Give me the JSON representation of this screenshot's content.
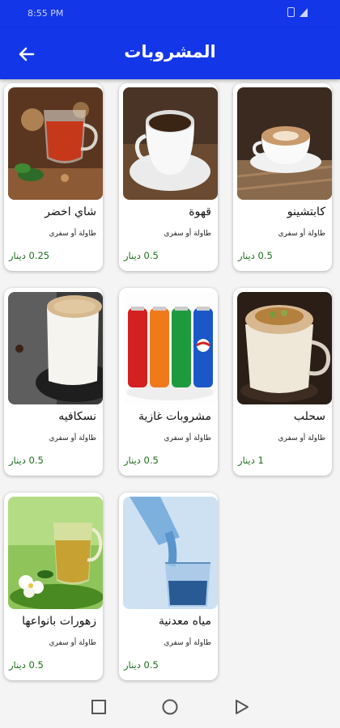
{
  "status_bar": {
    "time": "8:55 PM"
  },
  "app_bar": {
    "title": "المشروبات",
    "back_icon": "arrow-left-icon"
  },
  "products": [
    {
      "name": "كابتشينو",
      "service": "طاولة أو سفري",
      "price": "0.5 دينار"
    },
    {
      "name": "قهوة",
      "service": "طاولة أو سفري",
      "price": "0.5 دينار"
    },
    {
      "name": "شاي اخضر",
      "service": "طاولة أو سفري",
      "price": "0.25 دينار"
    },
    {
      "name": "سحلب",
      "service": "طاولة أو سفري",
      "price": "1 دينار"
    },
    {
      "name": "مشروبات غازية",
      "service": "طاولة أو سفري",
      "price": "0.5 دينار"
    },
    {
      "name": "نسكافيه",
      "service": "طاولة أو سفري",
      "price": "0.5 دينار"
    },
    {
      "name": "مياه معدنية",
      "service": "طاولة أو سفري",
      "price": "0.5 دينار"
    },
    {
      "name": "زهورات بانواعها",
      "service": "طاولة أو سفري",
      "price": "0.5 دينار"
    }
  ],
  "nav_bar": {
    "recents_icon": "square-icon",
    "home_icon": "circle-icon",
    "back_icon": "triangle-back-icon"
  },
  "colors": {
    "primary": "#1336e8",
    "price": "#1c6e1c"
  }
}
